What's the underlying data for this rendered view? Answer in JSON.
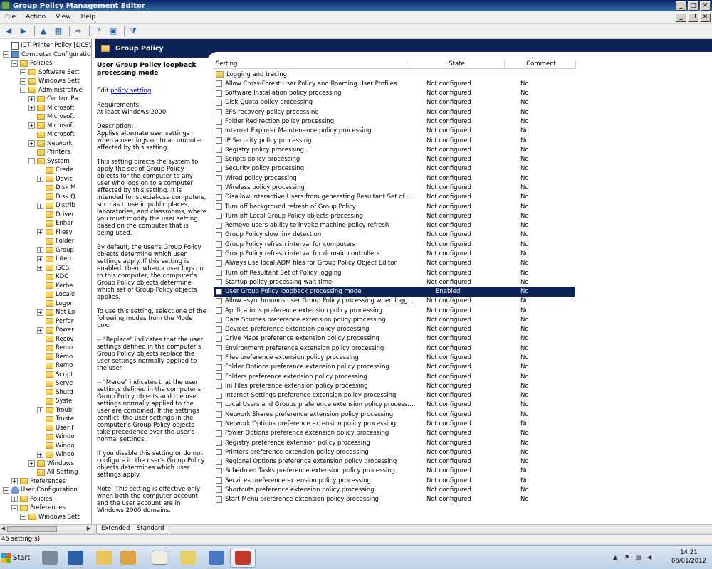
{
  "window": {
    "title": "Group Policy Management Editor"
  },
  "menu": [
    "File",
    "Action",
    "View",
    "Help"
  ],
  "tree": [
    {
      "label": "ICT Printer Policy [DCSVR",
      "level": 0,
      "exp": "",
      "icon": "pol"
    },
    {
      "label": "Computer Configuratio",
      "level": 0,
      "exp": "-",
      "icon": "pc"
    },
    {
      "label": "Policies",
      "level": 1,
      "exp": "-",
      "icon": "fld"
    },
    {
      "label": "Software Sett",
      "level": 2,
      "exp": "+",
      "icon": "fld"
    },
    {
      "label": "Windows Sett",
      "level": 2,
      "exp": "+",
      "icon": "fld"
    },
    {
      "label": "Administrative",
      "level": 2,
      "exp": "-",
      "icon": "fld"
    },
    {
      "label": "Control Pa",
      "level": 3,
      "exp": "+",
      "icon": "fld"
    },
    {
      "label": "Microsoft",
      "level": 3,
      "exp": "+",
      "icon": "fld"
    },
    {
      "label": "Microsoft",
      "level": 3,
      "exp": "",
      "icon": "fld"
    },
    {
      "label": "Microsoft",
      "level": 3,
      "exp": "+",
      "icon": "fld"
    },
    {
      "label": "Microsoft",
      "level": 3,
      "exp": "",
      "icon": "fld"
    },
    {
      "label": "Network",
      "level": 3,
      "exp": "+",
      "icon": "fld"
    },
    {
      "label": "Printers",
      "level": 3,
      "exp": "",
      "icon": "fld"
    },
    {
      "label": "System",
      "level": 3,
      "exp": "-",
      "icon": "fld"
    },
    {
      "label": "Crede",
      "level": 4,
      "exp": "",
      "icon": "fld"
    },
    {
      "label": "Devic",
      "level": 4,
      "exp": "+",
      "icon": "fld"
    },
    {
      "label": "Disk M",
      "level": 4,
      "exp": "",
      "icon": "fld"
    },
    {
      "label": "Disk Q",
      "level": 4,
      "exp": "",
      "icon": "fld"
    },
    {
      "label": "Distrib",
      "level": 4,
      "exp": "+",
      "icon": "fld"
    },
    {
      "label": "Driver",
      "level": 4,
      "exp": "",
      "icon": "fld"
    },
    {
      "label": "Enhar",
      "level": 4,
      "exp": "",
      "icon": "fld"
    },
    {
      "label": "Filesy",
      "level": 4,
      "exp": "+",
      "icon": "fld"
    },
    {
      "label": "Folder",
      "level": 4,
      "exp": "",
      "icon": "fld"
    },
    {
      "label": "Group",
      "level": 4,
      "exp": "+",
      "icon": "fld"
    },
    {
      "label": "Interr",
      "level": 4,
      "exp": "+",
      "icon": "fld"
    },
    {
      "label": "iSCSI",
      "level": 4,
      "exp": "+",
      "icon": "fld"
    },
    {
      "label": "KDC",
      "level": 4,
      "exp": "",
      "icon": "fld"
    },
    {
      "label": "Kerbe",
      "level": 4,
      "exp": "",
      "icon": "fld"
    },
    {
      "label": "Locale",
      "level": 4,
      "exp": "",
      "icon": "fld"
    },
    {
      "label": "Logon",
      "level": 4,
      "exp": "",
      "icon": "fld"
    },
    {
      "label": "Net Lo",
      "level": 4,
      "exp": "+",
      "icon": "fld"
    },
    {
      "label": "Perfor",
      "level": 4,
      "exp": "",
      "icon": "fld"
    },
    {
      "label": "Power",
      "level": 4,
      "exp": "+",
      "icon": "fld"
    },
    {
      "label": "Recov",
      "level": 4,
      "exp": "",
      "icon": "fld"
    },
    {
      "label": "Remo",
      "level": 4,
      "exp": "",
      "icon": "fld"
    },
    {
      "label": "Remo",
      "level": 4,
      "exp": "",
      "icon": "fld"
    },
    {
      "label": "Remo",
      "level": 4,
      "exp": "",
      "icon": "fld"
    },
    {
      "label": "Script",
      "level": 4,
      "exp": "",
      "icon": "fld"
    },
    {
      "label": "Serve",
      "level": 4,
      "exp": "",
      "icon": "fld"
    },
    {
      "label": "Shutd",
      "level": 4,
      "exp": "",
      "icon": "fld"
    },
    {
      "label": "Syste",
      "level": 4,
      "exp": "",
      "icon": "fld"
    },
    {
      "label": "Troub",
      "level": 4,
      "exp": "+",
      "icon": "fld"
    },
    {
      "label": "Truste",
      "level": 4,
      "exp": "",
      "icon": "fld"
    },
    {
      "label": "User F",
      "level": 4,
      "exp": "",
      "icon": "fld"
    },
    {
      "label": "Windo",
      "level": 4,
      "exp": "",
      "icon": "fld"
    },
    {
      "label": "Windo",
      "level": 4,
      "exp": "",
      "icon": "fld"
    },
    {
      "label": "Windo",
      "level": 4,
      "exp": "+",
      "icon": "fld"
    },
    {
      "label": "Windows",
      "level": 3,
      "exp": "+",
      "icon": "fld"
    },
    {
      "label": "All Setting",
      "level": 3,
      "exp": "",
      "icon": "fld"
    },
    {
      "label": "Preferences",
      "level": 1,
      "exp": "+",
      "icon": "fld"
    },
    {
      "label": "User Configuration",
      "level": 0,
      "exp": "-",
      "icon": "user"
    },
    {
      "label": "Policies",
      "level": 1,
      "exp": "+",
      "icon": "fld"
    },
    {
      "label": "Preferences",
      "level": 1,
      "exp": "-",
      "icon": "fld"
    },
    {
      "label": "Windows Sett",
      "level": 2,
      "exp": "+",
      "icon": "fld"
    }
  ],
  "banner": {
    "title": "Group Policy"
  },
  "description": {
    "title": "User Group Policy loopback processing mode",
    "edit_prefix": "Edit ",
    "edit_link": "policy setting",
    "requirements_label": "Requirements:",
    "requirements_value": "At least Windows 2000",
    "description_label": "Description:",
    "paragraphs": [
      "Applies alternate user settings when a user logs on to a computer affected by this setting.",
      "This setting directs the system to apply the set of Group Policy objects for the computer to any user who logs on to a computer affected by this setting. It is intended for special-use computers, such as those in public places, laboratories, and classrooms, where you must modify the user setting based on the computer that is being used.",
      "By default, the user's Group Policy objects determine which user settings apply. If this setting is enabled, then, when a user logs on to this computer, the computer's Group Policy objects determine which set of Group Policy objects applies.",
      "To use this setting, select one of the following modes from the Mode box:",
      "--   \"Replace\" indicates that the user settings defined in the computer's Group Policy objects replace the user settings normally applied to the user.",
      "--   \"Merge\" indicates that the user settings defined in the computer's Group Policy objects and the user settings normally applied to the user are combined. If the settings conflict, the user settings in the computer's Group Policy objects take precedence over the user's normal settings.",
      "If you disable this setting or do not configure it, the user's Group Policy objects determines which user settings apply.",
      "Note: This setting is effective only when both the computer account and the user account are in Windows 2000 domains."
    ]
  },
  "columns": {
    "setting": "Setting",
    "state": "State",
    "comment": "Comment"
  },
  "rows": [
    {
      "name": "Logging and tracing",
      "state": "",
      "comment": "",
      "folder": true
    },
    {
      "name": "Allow Cross-Forest User Policy and Roaming User Profiles",
      "state": "Not configured",
      "comment": "No"
    },
    {
      "name": "Software Installation policy processing",
      "state": "Not configured",
      "comment": "No"
    },
    {
      "name": "Disk Quota policy processing",
      "state": "Not configured",
      "comment": "No"
    },
    {
      "name": "EFS recovery policy processing",
      "state": "Not configured",
      "comment": "No"
    },
    {
      "name": "Folder Redirection policy processing",
      "state": "Not configured",
      "comment": "No"
    },
    {
      "name": "Internet Explorer Maintenance policy processing",
      "state": "Not configured",
      "comment": "No"
    },
    {
      "name": "IP Security policy processing",
      "state": "Not configured",
      "comment": "No"
    },
    {
      "name": "Registry policy processing",
      "state": "Not configured",
      "comment": "No"
    },
    {
      "name": "Scripts policy processing",
      "state": "Not configured",
      "comment": "No"
    },
    {
      "name": "Security policy processing",
      "state": "Not configured",
      "comment": "No"
    },
    {
      "name": "Wired policy processing",
      "state": "Not configured",
      "comment": "No"
    },
    {
      "name": "Wireless policy processing",
      "state": "Not configured",
      "comment": "No"
    },
    {
      "name": "Disallow Interactive Users from generating Resultant Set of Polic...",
      "state": "Not configured",
      "comment": "No"
    },
    {
      "name": "Turn off background refresh of Group Policy",
      "state": "Not configured",
      "comment": "No"
    },
    {
      "name": "Turn off Local Group Policy objects processing",
      "state": "Not configured",
      "comment": "No"
    },
    {
      "name": "Remove users ability to invoke machine policy refresh",
      "state": "Not configured",
      "comment": "No"
    },
    {
      "name": "Group Policy slow link detection",
      "state": "Not configured",
      "comment": "No"
    },
    {
      "name": "Group Policy refresh interval for computers",
      "state": "Not configured",
      "comment": "No"
    },
    {
      "name": "Group Policy refresh interval for domain controllers",
      "state": "Not configured",
      "comment": "No"
    },
    {
      "name": "Always use local ADM files for Group Policy Object Editor",
      "state": "Not configured",
      "comment": "No"
    },
    {
      "name": "Turn off Resultant Set of Policy logging",
      "state": "Not configured",
      "comment": "No"
    },
    {
      "name": "Startup policy processing wait time",
      "state": "Not configured",
      "comment": "No"
    },
    {
      "name": "User Group Policy loopback processing mode",
      "state": "Enabled",
      "comment": "No",
      "selected": true
    },
    {
      "name": "Allow asynchronous user Group Policy processing when logging o...",
      "state": "Not configured",
      "comment": "No"
    },
    {
      "name": "Applications preference extension policy processing",
      "state": "Not configured",
      "comment": "No"
    },
    {
      "name": "Data Sources preference extension policy processing",
      "state": "Not configured",
      "comment": "No"
    },
    {
      "name": "Devices preference extension policy processing",
      "state": "Not configured",
      "comment": "No"
    },
    {
      "name": "Drive Maps preference extension policy processing",
      "state": "Not configured",
      "comment": "No"
    },
    {
      "name": "Environment preference extension policy processing",
      "state": "Not configured",
      "comment": "No"
    },
    {
      "name": "Files preference extension policy processing",
      "state": "Not configured",
      "comment": "No"
    },
    {
      "name": "Folder Options preference extension policy processing",
      "state": "Not configured",
      "comment": "No"
    },
    {
      "name": "Folders preference extension policy processing",
      "state": "Not configured",
      "comment": "No"
    },
    {
      "name": "Ini Files preference extension policy processing",
      "state": "Not configured",
      "comment": "No"
    },
    {
      "name": "Internet Settings preference extension policy processing",
      "state": "Not configured",
      "comment": "No"
    },
    {
      "name": "Local Users and Groups preference extension policy processing",
      "state": "Not configured",
      "comment": "No"
    },
    {
      "name": "Network Shares preference extension policy processing",
      "state": "Not configured",
      "comment": "No"
    },
    {
      "name": "Network Options preference extension policy processing",
      "state": "Not configured",
      "comment": "No"
    },
    {
      "name": "Power Options preference extension policy processing",
      "state": "Not configured",
      "comment": "No"
    },
    {
      "name": "Registry preference extension policy processing",
      "state": "Not configured",
      "comment": "No"
    },
    {
      "name": "Printers preference extension policy processing",
      "state": "Not configured",
      "comment": "No"
    },
    {
      "name": "Regional Options preference extension policy processing",
      "state": "Not configured",
      "comment": "No"
    },
    {
      "name": "Scheduled Tasks preference extension policy processing",
      "state": "Not configured",
      "comment": "No"
    },
    {
      "name": "Services preference extension policy processing",
      "state": "Not configured",
      "comment": "No"
    },
    {
      "name": "Shortcuts preference extension policy processing",
      "state": "Not configured",
      "comment": "No"
    },
    {
      "name": "Start Menu preference extension policy processing",
      "state": "Not configured",
      "comment": "No"
    }
  ],
  "tabs": [
    "Extended",
    "Standard"
  ],
  "status": {
    "text": "45 setting(s)"
  },
  "taskbar": {
    "start_label": "Start",
    "time": "14:21",
    "date": "06/01/2012"
  },
  "colors": {
    "selection": "#0d2357",
    "title_gradient_start": "#0a246a",
    "link": "#0000cc"
  }
}
